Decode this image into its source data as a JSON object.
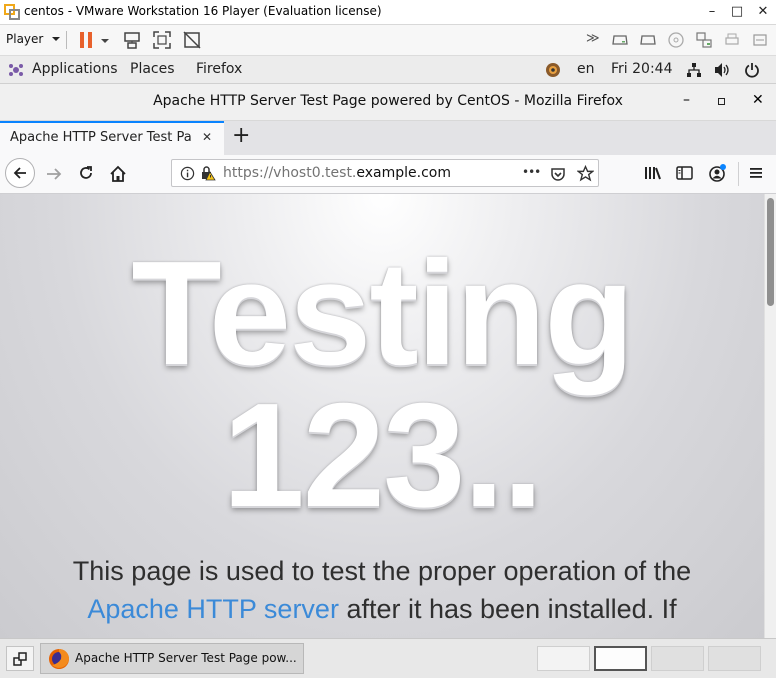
{
  "vmware": {
    "title": "centos - VMware Workstation 16 Player (Evaluation license)",
    "player_menu": "Player",
    "minimize_glyph": "–",
    "maximize_glyph": "□",
    "close_glyph": "✕",
    "more_glyph": "≫"
  },
  "gnome": {
    "applications": "Applications",
    "places": "Places",
    "firefox": "Firefox",
    "language": "en",
    "clock": "Fri 20:44"
  },
  "firefox": {
    "window_title": "Apache HTTP Server Test Page powered by CentOS - Mozilla Firefox",
    "tab_label": "Apache HTTP Server Test Pa",
    "new_tab_glyph": "+",
    "url_prefix": "https://vhost0.test.",
    "url_domain": "example.com",
    "page_actions_glyph": "•••"
  },
  "page": {
    "heading_line1": "Testing",
    "heading_line2": "123..",
    "para_before": "This page is used to test the proper operation of the",
    "link_text": "Apache HTTP server",
    "para_after": " after it has been installed. If"
  },
  "taskbar": {
    "window_label": "Apache HTTP Server Test Page pow..."
  },
  "colors": {
    "accent": "#0a84ff",
    "link": "#3b8ad8",
    "pause": "#e8612c"
  }
}
